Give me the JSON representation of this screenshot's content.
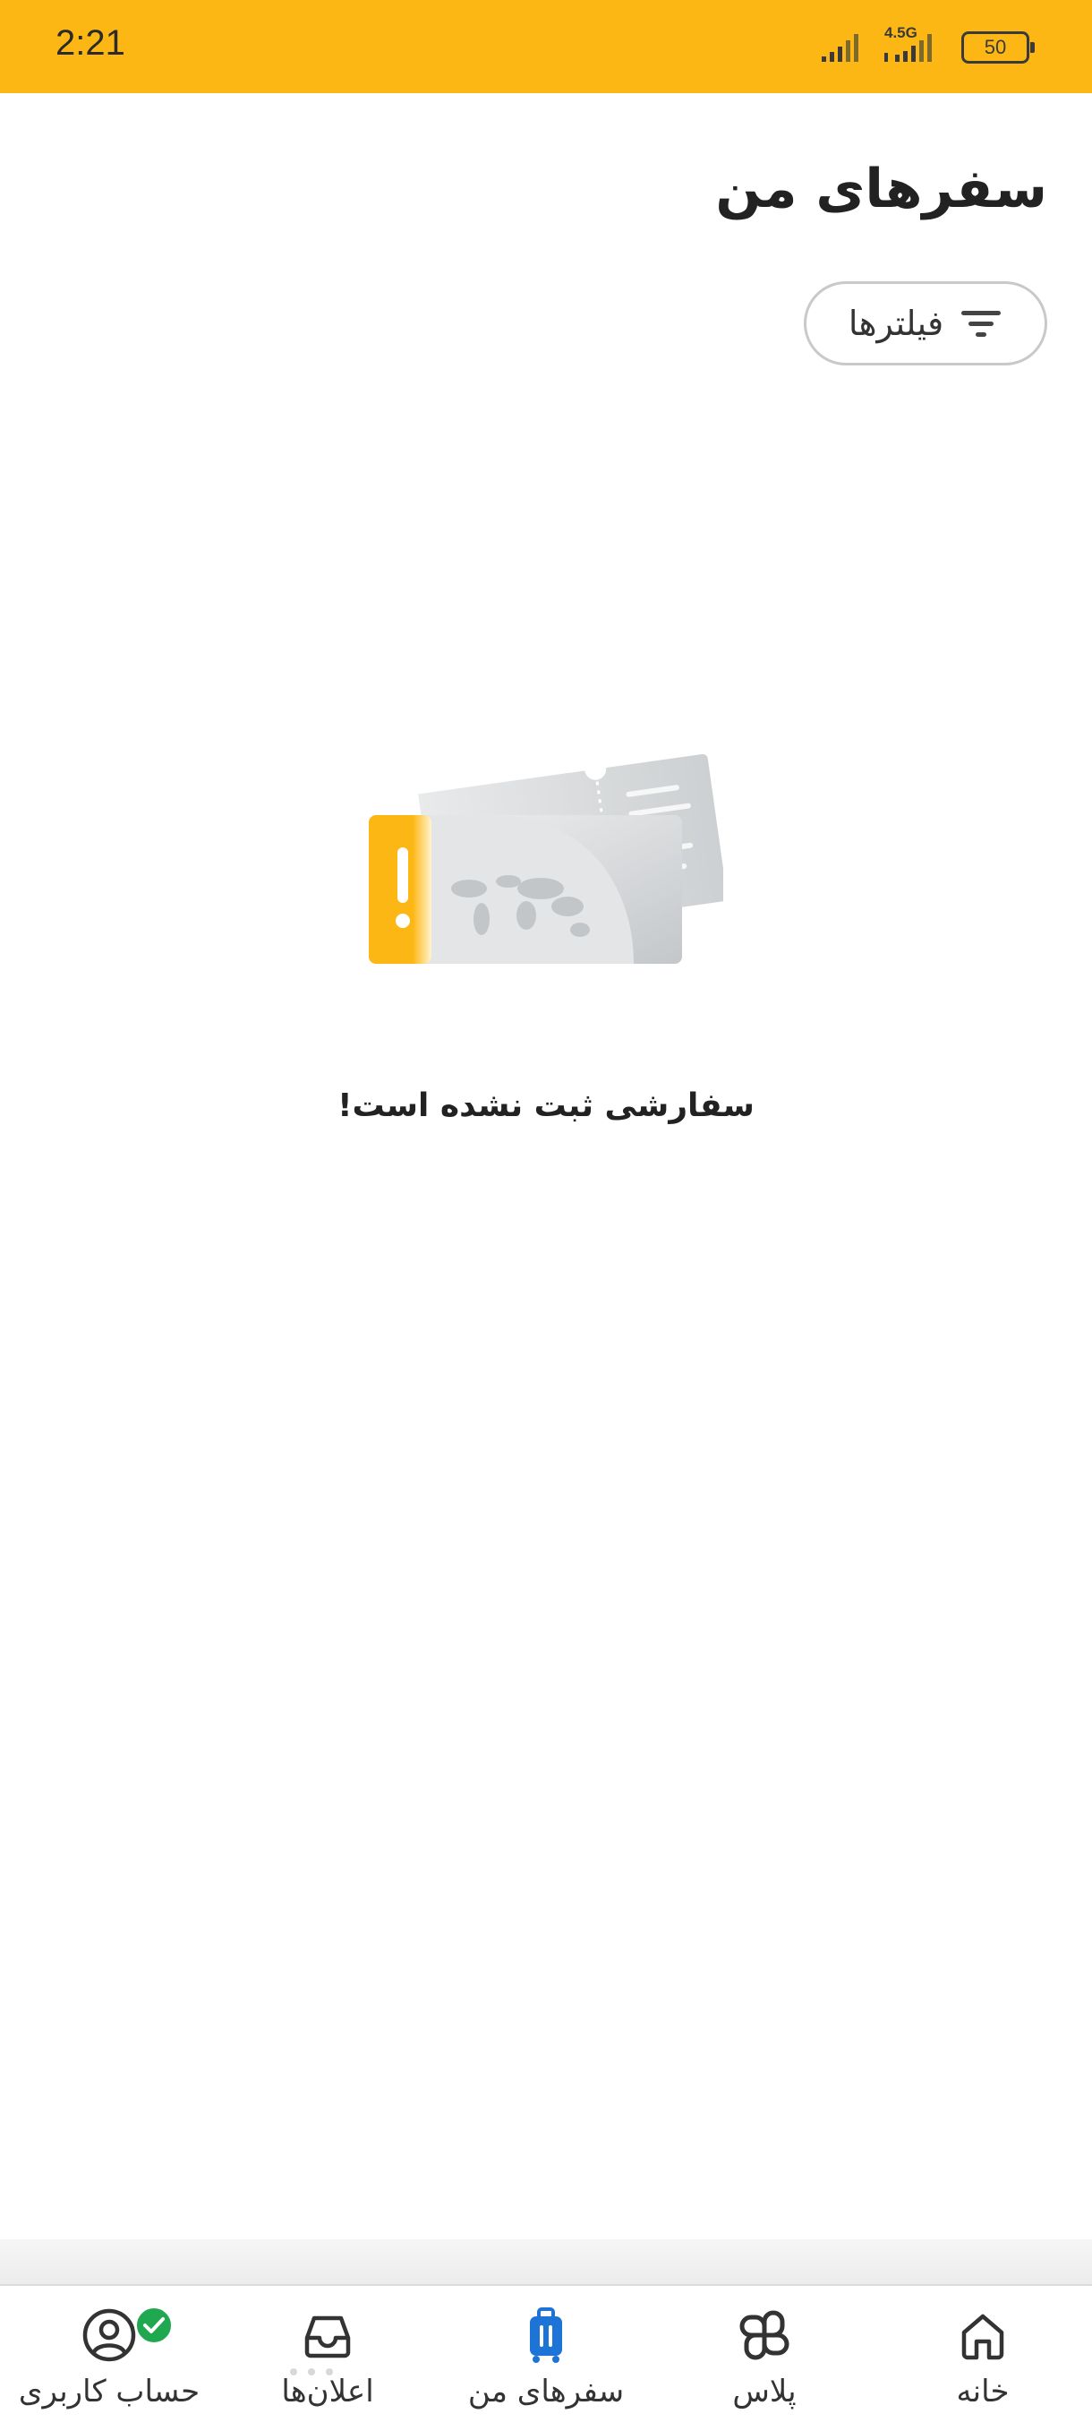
{
  "status_bar": {
    "time": "2:21",
    "network": "4.5G",
    "battery": "50",
    "background_color": "#FDB714"
  },
  "header": {
    "title": "سفرهای من",
    "filter_label": "فیلترها",
    "filter_icon": "filter-icon"
  },
  "empty_state": {
    "illustration": "empty-ticket-illustration",
    "message": "سفارشی ثبت نشده است!"
  },
  "bottom_nav": {
    "active_color": "#1E73D6",
    "items": [
      {
        "label": "خانه",
        "icon": "home-icon",
        "active": false
      },
      {
        "label": "پلاس",
        "icon": "plus-icon",
        "active": false
      },
      {
        "label": "سفرهای من",
        "icon": "luggage-icon",
        "active": true
      },
      {
        "label": "اعلان‌ها",
        "icon": "inbox-icon",
        "active": false
      },
      {
        "label": "حساب کاربری",
        "icon": "user-account-icon",
        "active": false
      }
    ]
  }
}
